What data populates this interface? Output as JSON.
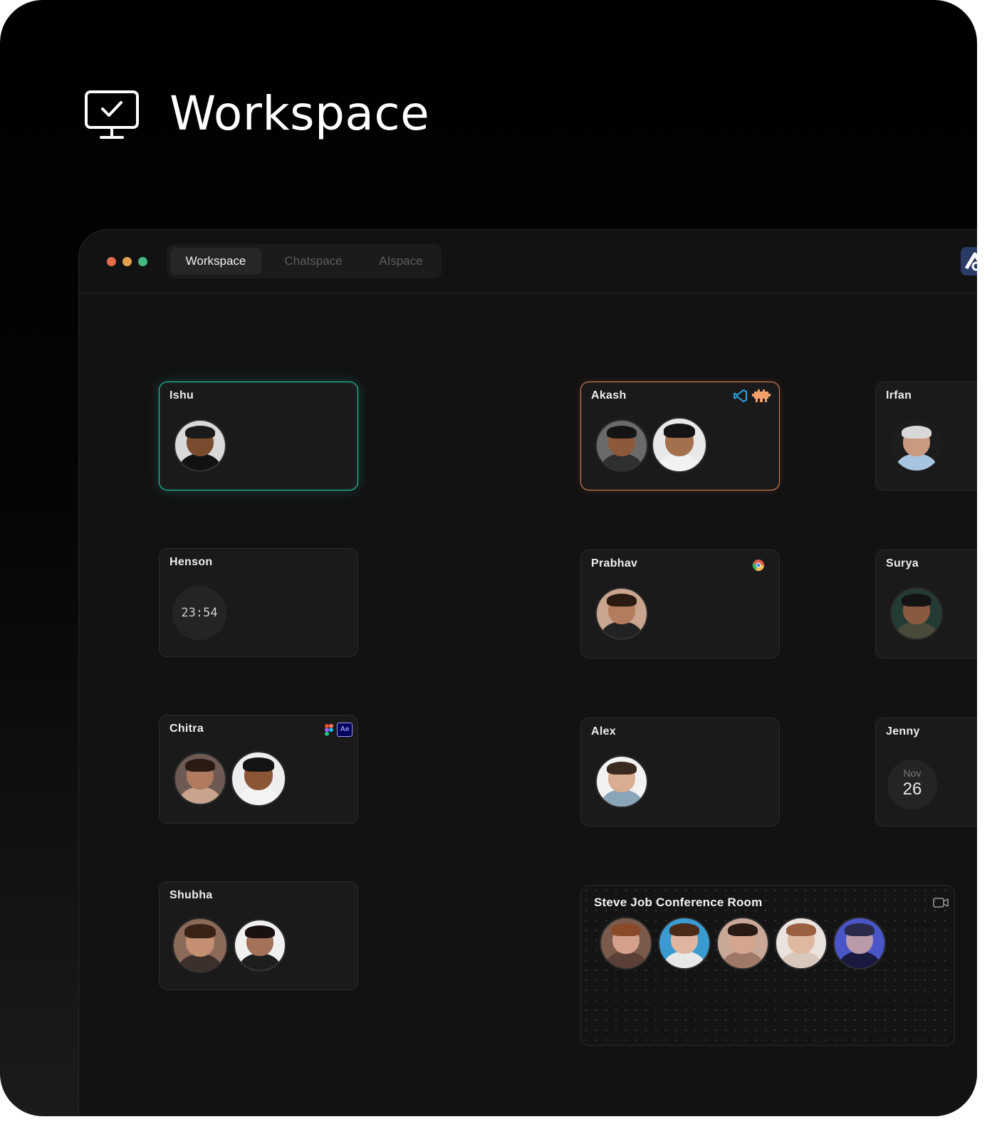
{
  "hero": {
    "title": "Workspace",
    "icon": "monitor-check-icon"
  },
  "window": {
    "traffic_lights": [
      "#e26d4e",
      "#e5a04e",
      "#43b97f"
    ],
    "tabs": [
      {
        "label": "Workspace",
        "active": true
      },
      {
        "label": "Chatspace",
        "active": false
      },
      {
        "label": "AIspace",
        "active": false
      }
    ],
    "app_logo": "app-logo-icon"
  },
  "members": [
    {
      "name": "Ishu",
      "status": "active",
      "avatars": 1
    },
    {
      "name": "Akash",
      "status": "in-call",
      "apps": [
        "vscode-icon",
        "ghost-app-icon"
      ],
      "avatars": 2
    },
    {
      "name": "Irfan",
      "avatars": 1
    },
    {
      "name": "Henson",
      "clock": "23:54"
    },
    {
      "name": "Prabhav",
      "apps": [
        "chrome-icon"
      ],
      "avatars": 1
    },
    {
      "name": "Surya",
      "avatars": 1
    },
    {
      "name": "Chitra",
      "apps": [
        "figma-icon",
        "after-effects-icon"
      ],
      "avatars": 2,
      "app_badge": "Ae"
    },
    {
      "name": "Alex",
      "avatars": 1
    },
    {
      "name": "Jenny",
      "date": {
        "month": "Nov",
        "day": "26"
      }
    },
    {
      "name": "Shubha",
      "avatars": 2
    }
  ],
  "conference_room": {
    "title": "Steve Job Conference Room",
    "icon": "video-camera-icon",
    "participants": 5
  }
}
